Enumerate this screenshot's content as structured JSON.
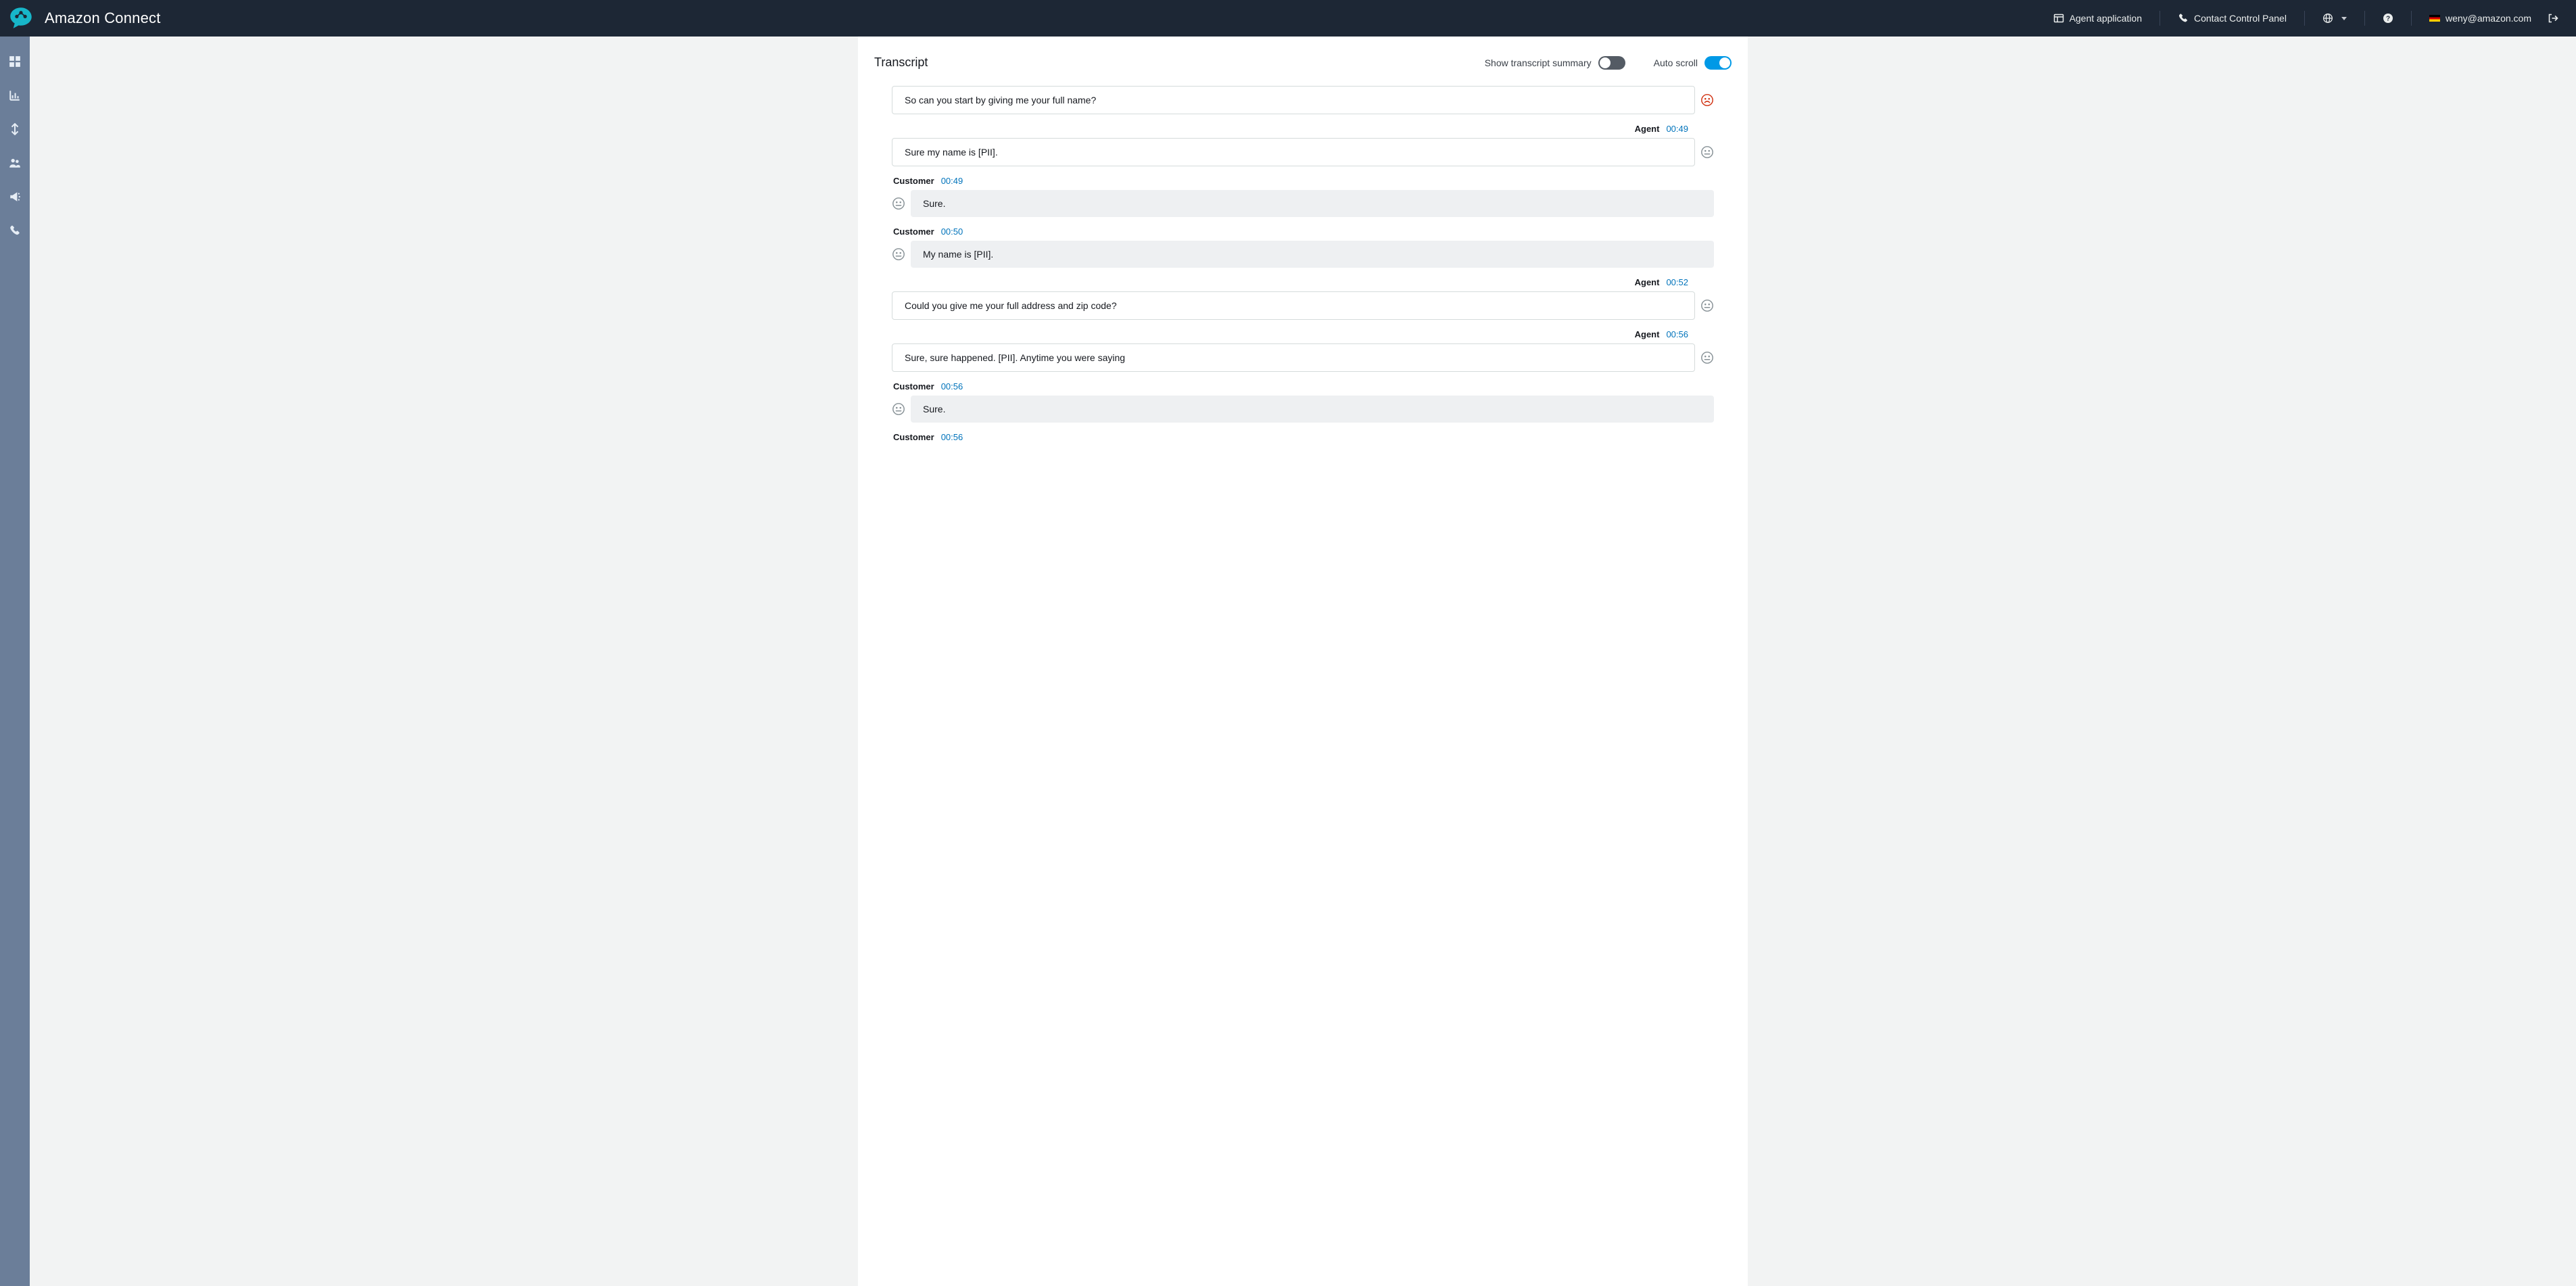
{
  "header": {
    "product": "Amazon Connect",
    "agent_app": "Agent application",
    "ccp": "Contact Control Panel",
    "user_email": "weny@amazon.com"
  },
  "section": {
    "title": "Transcript",
    "toggle_summary_label": "Show transcript summary",
    "toggle_summary_on": false,
    "toggle_autoscroll_label": "Auto scroll",
    "toggle_autoscroll_on": true
  },
  "transcript": [
    {
      "role": "Agent",
      "time": "",
      "text": "So can you start by giving me your full name?",
      "sentiment": "neg",
      "show_meta": false
    },
    {
      "role": "Agent",
      "time": "00:49",
      "text": "Sure my name is [PII].",
      "sentiment": "neutral",
      "show_meta": true
    },
    {
      "role": "Customer",
      "time": "00:49",
      "text": "Sure.",
      "sentiment": "neutral",
      "show_meta": true
    },
    {
      "role": "Customer",
      "time": "00:50",
      "text": "My name is [PII].",
      "sentiment": "neutral",
      "show_meta": true
    },
    {
      "role": "Agent",
      "time": "00:52",
      "text": "Could you give me your full address and zip code?",
      "sentiment": "neutral",
      "show_meta": true
    },
    {
      "role": "Agent",
      "time": "00:56",
      "text": "Sure, sure happened. [PII]. Anytime you were saying",
      "sentiment": "neutral",
      "show_meta": true
    },
    {
      "role": "Customer",
      "time": "00:56",
      "text": "Sure.",
      "sentiment": "neutral",
      "show_meta": true
    },
    {
      "role": "Customer",
      "time": "00:56",
      "text": "",
      "sentiment": "",
      "show_meta": true
    }
  ]
}
